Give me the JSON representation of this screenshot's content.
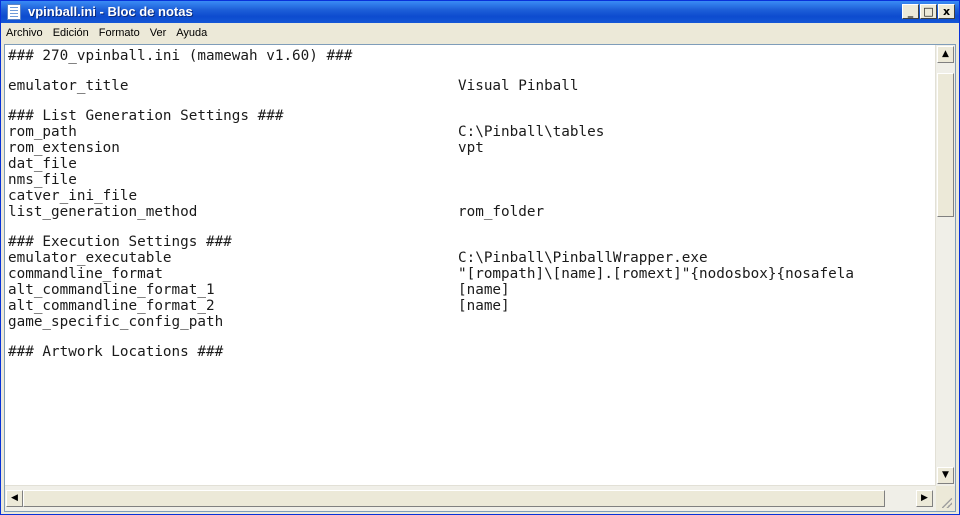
{
  "window": {
    "title": "vpinball.ini - Bloc de notas",
    "icon": "notepad-icon",
    "buttons": {
      "minimize": "_",
      "maximize": "□",
      "close": "x"
    }
  },
  "menu": [
    "Archivo",
    "Edición",
    "Formato",
    "Ver",
    "Ayuda"
  ],
  "document": {
    "lines": [
      {
        "key": "### 270_vpinball.ini (mamewah v1.60) ###",
        "value": ""
      },
      {
        "key": "emulator_title",
        "value": "Visual Pinball"
      },
      {
        "key": "### List Generation Settings ###",
        "value": ""
      },
      {
        "key": "rom_path",
        "value": "C:\\Pinball\\tables"
      },
      {
        "key": "rom_extension",
        "value": "vpt"
      },
      {
        "key": "dat_file",
        "value": ""
      },
      {
        "key": "nms_file",
        "value": ""
      },
      {
        "key": "catver_ini_file",
        "value": ""
      },
      {
        "key": "list_generation_method",
        "value": "rom_folder"
      },
      {
        "key": "### Execution Settings ###",
        "value": ""
      },
      {
        "key": "emulator_executable",
        "value": "C:\\Pinball\\PinballWrapper.exe"
      },
      {
        "key": "commandline_format",
        "value": "\"[rompath]\\[name].[romext]\"{nodosbox}{nosafela"
      },
      {
        "key": "alt_commandline_format_1",
        "value": "[name]"
      },
      {
        "key": "alt_commandline_format_2",
        "value": "[name]"
      },
      {
        "key": "game_specific_config_path",
        "value": ""
      },
      {
        "key": "### Artwork Locations ###",
        "value": ""
      }
    ]
  },
  "scrollbars": {
    "up_arrow": "▲",
    "down_arrow": "▼",
    "left_arrow": "◀",
    "right_arrow": "▶"
  }
}
